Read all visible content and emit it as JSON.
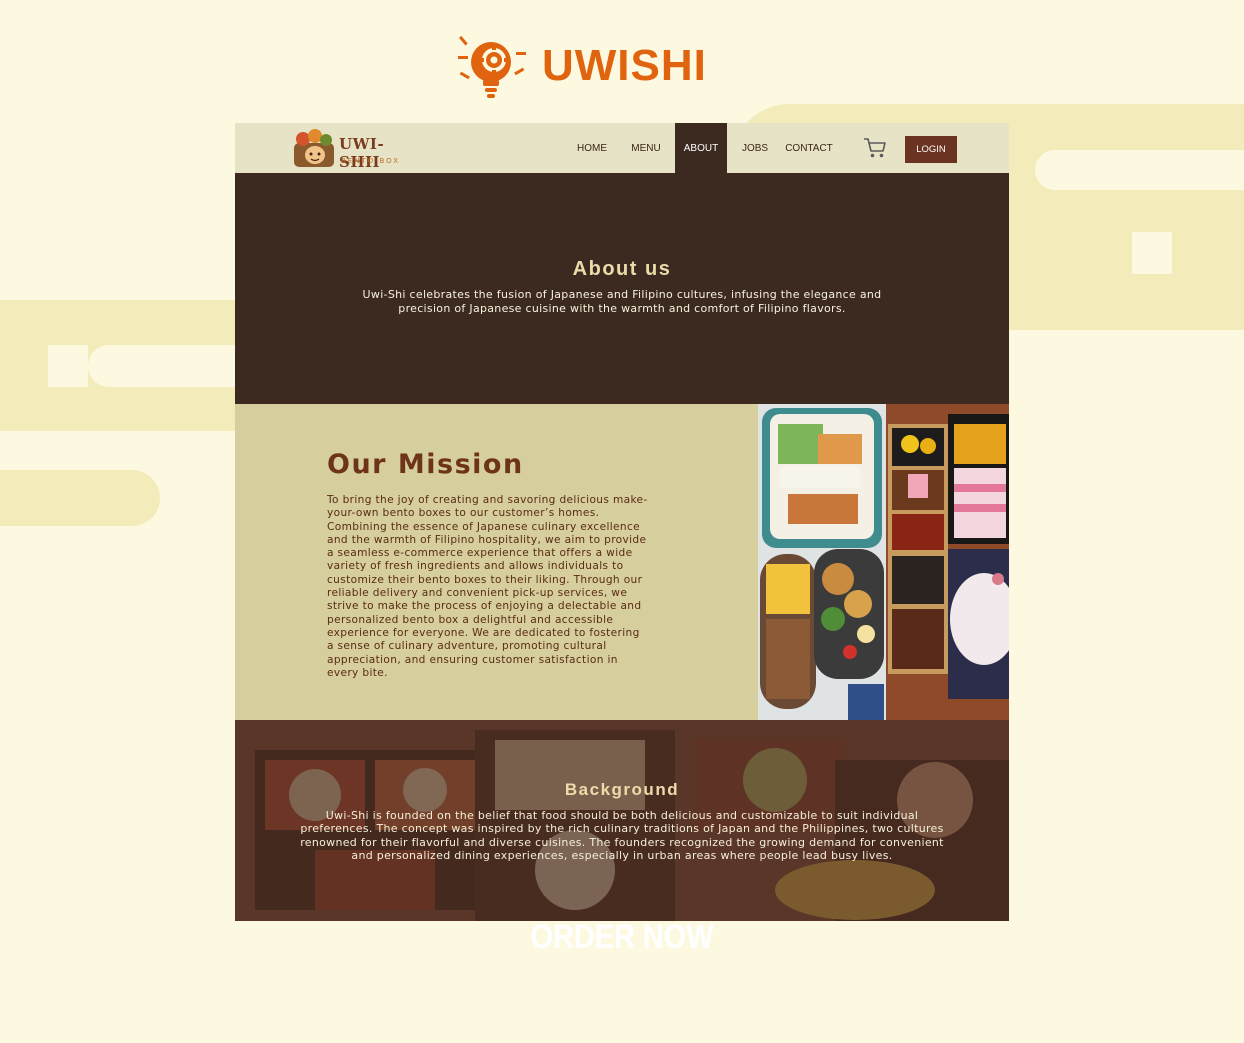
{
  "brand": {
    "name": "UWISHI",
    "color": "#e0640f",
    "icon": "lightbulb-gear-icon"
  },
  "nav": {
    "logo": {
      "title": "UWI-SHII",
      "subtitle": "BENTO BOX"
    },
    "items": [
      {
        "label": "HOME"
      },
      {
        "label": "MENU"
      },
      {
        "label": "ABOUT"
      },
      {
        "label": "JOBS"
      },
      {
        "label": "CONTACT"
      }
    ],
    "active": "ABOUT",
    "cart_icon": "cart-icon",
    "login_label": "LOGIN"
  },
  "about": {
    "title": "About us",
    "text": "Uwi-Shi celebrates the fusion of Japanese and Filipino cultures, infusing the elegance and precision of Japanese cuisine with the warmth and comfort of Filipino flavors."
  },
  "mission": {
    "title": "Our Mission",
    "text": "To bring the joy of creating and savoring delicious make-your-own bento boxes to our customer’s homes. Combining the essence of Japanese culinary excellence and the warmth of Filipino hospitality, we aim to provide a seamless e-commerce experience that offers a wide variety of fresh ingredients and allows individuals to customize their bento boxes to their liking. Through our reliable delivery and convenient pick-up services, we strive to make the process of enjoying a delectable and personalized bento box a delightful and accessible experience for everyone. We are dedicated to fostering a sense of culinary adventure, promoting cultural appreciation, and ensuring customer satisfaction in every bite."
  },
  "background": {
    "title": "Background",
    "text": "Uwi-Shi is founded on the belief that food should be both delicious and customizable to suit individual preferences. The concept was inspired by the rich culinary traditions of Japan and the Philippines, two cultures renowned for their flavorful and diverse cuisines. The founders recognized the growing demand for convenient and personalized dining experiences, especially in urban areas where people lead busy lives."
  },
  "cta": {
    "label": "ORDER NOW"
  },
  "colors": {
    "page_bg": "#fdf9e1",
    "dark_brown": "#3c2920",
    "khaki": "#d6ce9d",
    "nav_bg": "#e6e3c6",
    "accent_brown": "#6b3322"
  }
}
